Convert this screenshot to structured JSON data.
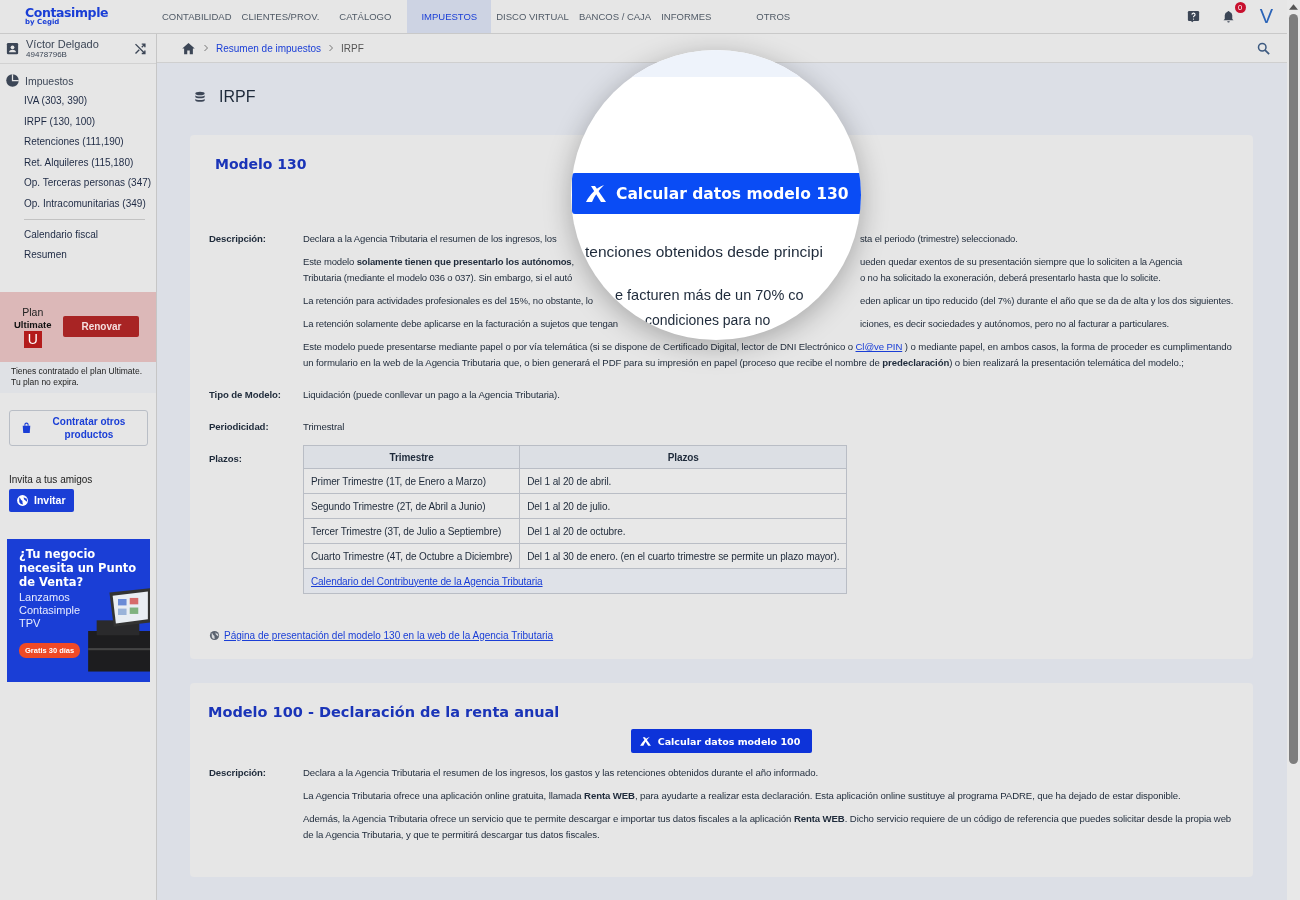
{
  "app": {
    "logo": "Contasimple",
    "logo_sub": "by Cegid"
  },
  "nav": [
    {
      "label": "CONTABILIDAD",
      "selected": false
    },
    {
      "label": "CLIENTES/PROV.",
      "selected": false
    },
    {
      "label": "CATÁLOGO",
      "selected": false
    },
    {
      "label": "IMPUESTOS",
      "selected": true
    },
    {
      "label": "DISCO VIRTUAL",
      "selected": false
    },
    {
      "label": "BANCOS / CAJA",
      "selected": false
    },
    {
      "label": "INFORMES",
      "selected": false
    },
    {
      "label": "OTROS",
      "selected": false
    }
  ],
  "header": {
    "notification_count": "0",
    "avatar": "V"
  },
  "user": {
    "name": "Víctor Delgado",
    "tax_id": "49478796B"
  },
  "sidebar": {
    "section": "Impuestos",
    "items": [
      "IVA (303, 390)",
      "IRPF (130, 100)",
      "Retenciones (111,190)",
      "Ret. Alquileres (115,180)",
      "Op. Terceras personas (347)",
      "Op. Intracomunitarias (349)"
    ],
    "extra_items": [
      "Calendario fiscal",
      "Resumen"
    ]
  },
  "plan": {
    "label": "Plan",
    "name": "Ultimate",
    "badge": "U",
    "button": "Renovar",
    "note": "Tienes contratado el plan Ultimate. Tu plan no expira."
  },
  "contract_button": "Contratar otros productos",
  "invite": {
    "label": "Invita a tus amigos",
    "button": "Invitar"
  },
  "ad": {
    "headline": "¿Tu negocio necesita un Punto de Venta?",
    "body": "Lanzamos Contasimple TPV",
    "badge": "Gratis 30 días"
  },
  "breadcrumb": [
    {
      "label": "Resumen de impuestos",
      "kind": "link"
    },
    {
      "label": "IRPF",
      "kind": "current"
    }
  ],
  "page_title": "IRPF",
  "models": [
    {
      "title": "Modelo 130",
      "fields": [
        {
          "label": "Descripción:",
          "kind": "text",
          "paragraphs": [
            {
              "lines": [
                {
                  "left": "Declara a la Agencia Tributaria el resumen de los ingresos, los",
                  "right": "sta el periodo (trimestre) seleccionado."
                }
              ]
            },
            {
              "lines": [
                {
                  "left": "Este modelo **solamente tienen que presentarlo los autónomos**,",
                  "right": "ueden quedar exentos de su presentación siempre que lo soliciten a la Agencia"
                },
                {
                  "left": "Tributaria (mediante el modelo 036 o 037). Sin embargo, si el autó",
                  "right": "o no ha solicitado la exoneración, deberá presentarlo hasta que lo solicite."
                }
              ]
            },
            {
              "lines": [
                {
                  "left": "La retención para actividades profesionales es del 15%, no obstante, lo",
                  "right": "eden aplicar un tipo reducido (del 7%) durante el año que se da de alta y los dos siguientes."
                }
              ]
            },
            {
              "lines": [
                {
                  "left": "La retención solamente debe aplicarse en la facturación a sujetos que tengan",
                  "right": "iciones, es decir sociedades y autónomos, pero no al facturar a particulares."
                }
              ]
            },
            {
              "parts": [
                {
                  "text": "Este modelo puede presentarse mediante papel o por vía telemática (si se dispone de Certificado Digital, lector de DNI Electrónico o "
                },
                {
                  "link": "Cl@ve PIN"
                },
                {
                  "text": " ) o mediante papel, en ambos casos, la forma de proceder es cumplimentando un formulario en la web de la Agencia Tributaria que, o bien generará el PDF para su impresión en papel (proceso que recibe el nombre de **predeclaración**) o bien realizará la presentación telemática del modelo.;"
                }
              ]
            }
          ]
        },
        {
          "label": "Tipo de Modelo:",
          "kind": "text",
          "paragraphs": [
            {
              "text": "Liquidación (puede conllevar un pago a la Agencia Tributaria)."
            }
          ]
        },
        {
          "label": "Periodicidad:",
          "kind": "text",
          "paragraphs": [
            {
              "text": "Trimestral"
            }
          ]
        },
        {
          "label": "Plazos:",
          "kind": "table",
          "columns": [
            "Trimestre",
            "Plazos"
          ],
          "rows": [
            [
              "Primer Trimestre (1T, de Enero a Marzo)",
              "Del 1 al 20 de abril."
            ],
            [
              "Segundo Trimestre (2T, de Abril a Junio)",
              "Del 1 al 20 de julio."
            ],
            [
              "Tercer Trimestre (3T, de Julio a Septiembre)",
              "Del 1 al 20 de octubre."
            ],
            [
              "Cuarto Trimestre (4T, de Octubre a Diciembre)",
              "Del 1 al 30 de enero. (en el cuarto trimestre se permite un plazo mayor)."
            ]
          ],
          "footer_link": "Calendario del Contribuyente de la Agencia Tributaria"
        }
      ],
      "link": "Página de presentación del modelo 130 en la web de la Agencia Tributaria"
    },
    {
      "title": "Modelo 100 - Declaración de la renta anual",
      "button": "Calcular datos modelo 100",
      "fields": [
        {
          "label": "Descripción:",
          "kind": "text",
          "paragraphs": [
            {
              "text": "Declara a la Agencia Tributaria el resumen de los ingresos, los gastos y las retenciones obtenidos durante el año informado."
            },
            {
              "text": "La Agencia Tributaria ofrece una aplicación online gratuita, llamada **Renta WEB**, para ayudarte a realizar esta declaración. Esta aplicación online sustituye al programa PADRE, que ha dejado de estar disponible."
            },
            {
              "text": "Además, la Agencia Tributaria ofrece un servicio que te permite descargar e importar tus datos fiscales a la aplicación **Renta WEB**. Dicho servicio requiere de un código de referencia que puedes solicitar desde la propia web de la Agencia Tributaria, y que te permitirá descargar tus datos fiscales."
            }
          ]
        }
      ]
    }
  ],
  "magnifier": {
    "button": "Calcular datos modelo 130",
    "lines": [
      "tenciones obtenidos desde principi",
      "e facturen más de un 70% co",
      "condiciones para no"
    ]
  }
}
